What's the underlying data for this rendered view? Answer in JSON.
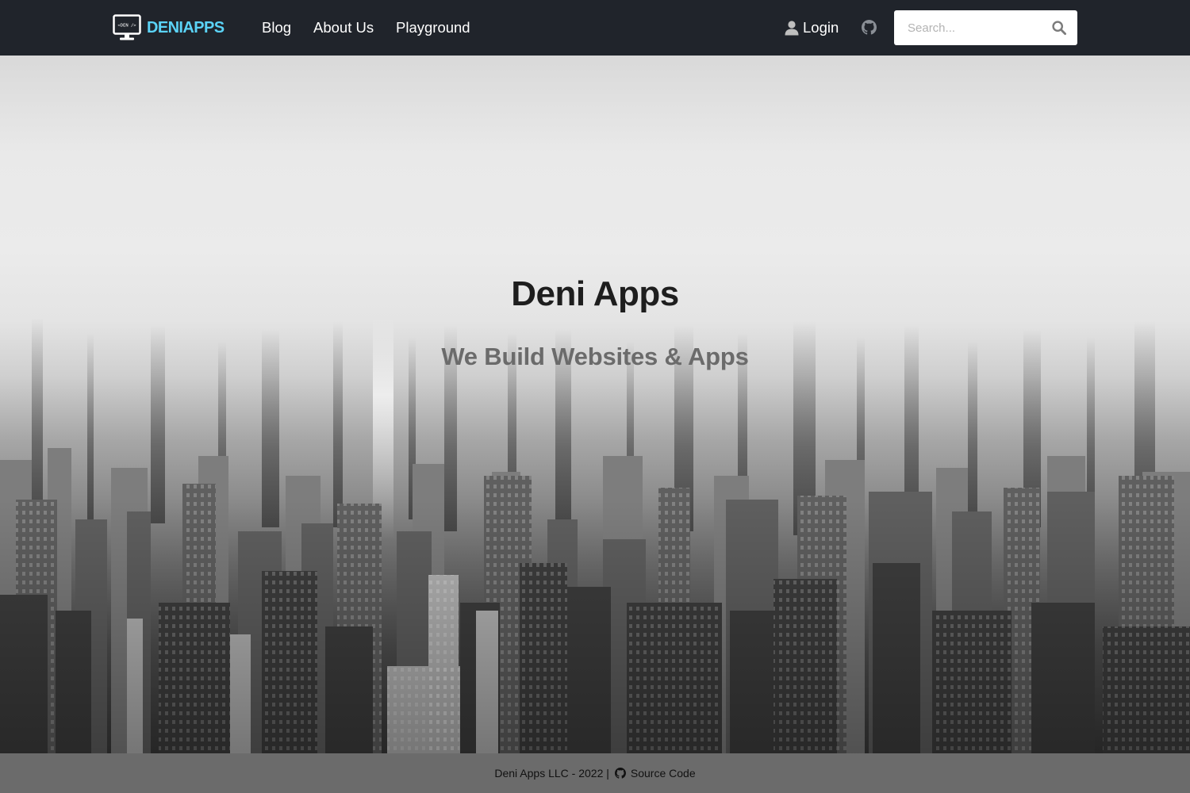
{
  "nav": {
    "brand": "DENIAPPS",
    "brand_icon_text": "<DEN />",
    "links": [
      "Blog",
      "About Us",
      "Playground"
    ],
    "login": "Login",
    "search_placeholder": "Search..."
  },
  "hero": {
    "title": "Deni Apps",
    "subtitle": "We Build Websites & Apps"
  },
  "footer": {
    "copyright": "Deni Apps LLC - 2022 |",
    "source_link": "Source Code"
  },
  "colors": {
    "navbar_bg": "#20242b",
    "brand_accent": "#5bd3f7",
    "footer_bg": "#6b6b6b"
  },
  "icons": [
    "monitor-logo-icon",
    "user-icon",
    "github-icon",
    "search-icon"
  ]
}
